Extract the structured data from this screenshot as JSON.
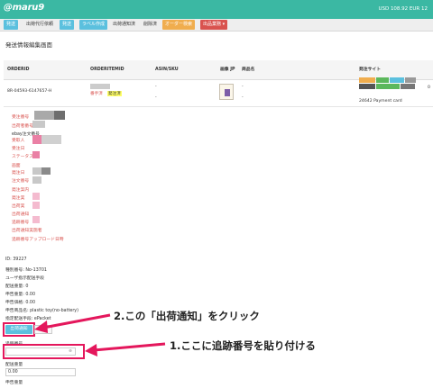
{
  "header": {
    "logo": "@maru9",
    "rates": "USD 108.92  EUR 12"
  },
  "nav": [
    {
      "label": "発送",
      "style": "blue"
    },
    {
      "label": "出荷代行依頼",
      "style": "plain"
    },
    {
      "label": "発送",
      "style": "blue"
    },
    {
      "label": "ラベル作成",
      "style": "blue"
    },
    {
      "label": "出荷通知済",
      "style": "plain"
    },
    {
      "label": "削除済",
      "style": "plain"
    },
    {
      "label": "オーダー検索",
      "style": "orange"
    },
    {
      "label": "出品業務 ▾",
      "style": "red"
    }
  ],
  "page_title": "発送情報編集画面",
  "table": {
    "headers": [
      "ORDERID",
      "ORDERITEMID",
      "ASIN/SKU",
      "画像 JP",
      "商品名",
      "発注サイト"
    ],
    "row": {
      "order_id": "8R-04593-6147657-H",
      "item_status_red": "番手済",
      "item_status_yellow": "発注済",
      "asin_dash1": "-",
      "asin_dash2": "-",
      "name_dash1": "-",
      "name_dash2": "-",
      "payment": "24642 Payment card",
      "col_cut": "0"
    }
  },
  "details": [
    "受注番号",
    "出荷者番号",
    "ebay注文番号",
    "受取人",
    "受注日",
    "ステータス",
    "画面",
    "発注日",
    "注文番号",
    "発注案内",
    "発注実",
    "出荷実",
    "出荷通知",
    "追跡番号",
    "出荷通知実施者",
    "追跡番号アップロード日時"
  ],
  "info": [
    "ID: 39227",
    "種別番号: No-13701",
    "ユーザ指示配送手段",
    "配送重量: 0",
    "申告重量: 0.00",
    "申告価格: 0.00",
    "申告商品名: plastic toy(no-battery)",
    "指定配送手段: ePacket"
  ],
  "ship_button": "出荷通知",
  "tracking_label": "追跡番号",
  "weight_label": "配送重量",
  "weight_value": "0.00",
  "declared_label": "申告重量",
  "callouts": {
    "step2": "2.この「出荷通知」をクリック",
    "step1": "1.ここに追跡番号を貼り付ける"
  },
  "colors": {
    "header": "#3bb8a3",
    "highlight": "#e4175c"
  }
}
